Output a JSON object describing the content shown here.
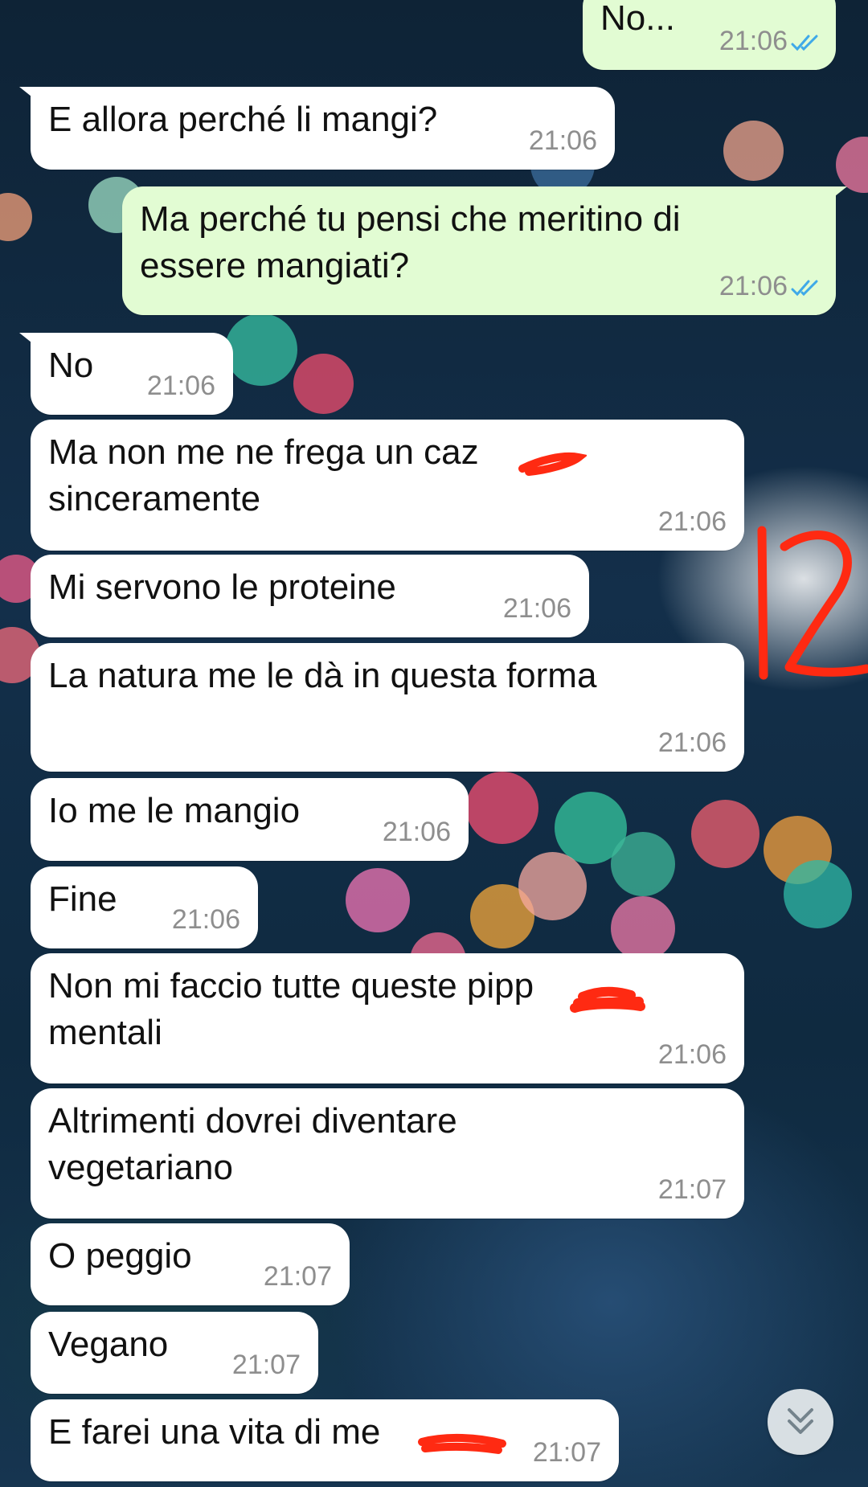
{
  "chat": {
    "messages": [
      {
        "direction": "out",
        "text_lines": [
          "No..."
        ],
        "time": "21:06",
        "status": "read"
      },
      {
        "direction": "in",
        "text_lines": [
          "E allora perché li mangi?"
        ],
        "time": "21:06"
      },
      {
        "direction": "out",
        "text_lines": [
          "Ma perché tu pensi che meritino di",
          "essere mangiati?"
        ],
        "time": "21:06",
        "status": "read"
      },
      {
        "direction": "in",
        "text_lines": [
          "No"
        ],
        "time": "21:06"
      },
      {
        "direction": "in",
        "text_lines": [
          "Ma non me ne frega un caz",
          "sinceramente"
        ],
        "time": "21:06"
      },
      {
        "direction": "in",
        "text_lines": [
          "Mi servono le proteine"
        ],
        "time": "21:06"
      },
      {
        "direction": "in",
        "text_lines": [
          "La natura me le dà in questa forma"
        ],
        "time": "21:06"
      },
      {
        "direction": "in",
        "text_lines": [
          "Io me le mangio"
        ],
        "time": "21:06"
      },
      {
        "direction": "in",
        "text_lines": [
          "Fine"
        ],
        "time": "21:06"
      },
      {
        "direction": "in",
        "text_lines": [
          "Non mi faccio tutte queste pipp",
          "mentali"
        ],
        "time": "21:06"
      },
      {
        "direction": "in",
        "text_lines": [
          "Altrimenti dovrei diventare",
          "vegetariano"
        ],
        "time": "21:07"
      },
      {
        "direction": "in",
        "text_lines": [
          "O peggio"
        ],
        "time": "21:07"
      },
      {
        "direction": "in",
        "text_lines": [
          "Vegano"
        ],
        "time": "21:07"
      },
      {
        "direction": "in",
        "text_lines": [
          "E farei una vita di me"
        ],
        "time": "21:07"
      }
    ]
  },
  "annotation": {
    "text": "12",
    "color": "#ff2a12"
  },
  "scroll_button": {
    "icon": "double-chevron-down-icon"
  },
  "colors": {
    "incoming_bubble": "#ffffff",
    "outgoing_bubble": "#e2fcd3",
    "read_ticks": "#3fa9e8",
    "timestamp": "#8e8e8e",
    "redaction": "#ff2a12"
  }
}
